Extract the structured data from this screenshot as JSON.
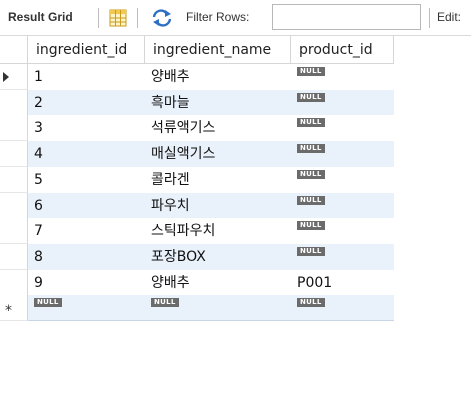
{
  "toolbar": {
    "title": "Result Grid",
    "grid_icon": "grid-icon",
    "refresh_icon": "refresh-icon",
    "filter_label": "Filter Rows:",
    "filter_value": "",
    "edit_label": "Edit:"
  },
  "columns": [
    "ingredient_id",
    "ingredient_name",
    "product_id"
  ],
  "null_text": "NULL",
  "rows": [
    {
      "ingredient_id": "1",
      "ingredient_name": "양배추",
      "product_id": null
    },
    {
      "ingredient_id": "2",
      "ingredient_name": "흑마늘",
      "product_id": null
    },
    {
      "ingredient_id": "3",
      "ingredient_name": "석류액기스",
      "product_id": null
    },
    {
      "ingredient_id": "4",
      "ingredient_name": "매실액기스",
      "product_id": null
    },
    {
      "ingredient_id": "5",
      "ingredient_name": "콜라겐",
      "product_id": null
    },
    {
      "ingredient_id": "6",
      "ingredient_name": "파우치",
      "product_id": null
    },
    {
      "ingredient_id": "7",
      "ingredient_name": "스틱파우치",
      "product_id": null
    },
    {
      "ingredient_id": "8",
      "ingredient_name": "포장BOX",
      "product_id": null
    },
    {
      "ingredient_id": "9",
      "ingredient_name": "양배추",
      "product_id": "P001"
    }
  ],
  "new_row_marker": "*",
  "current_row_marker": "arrow-right-icon"
}
